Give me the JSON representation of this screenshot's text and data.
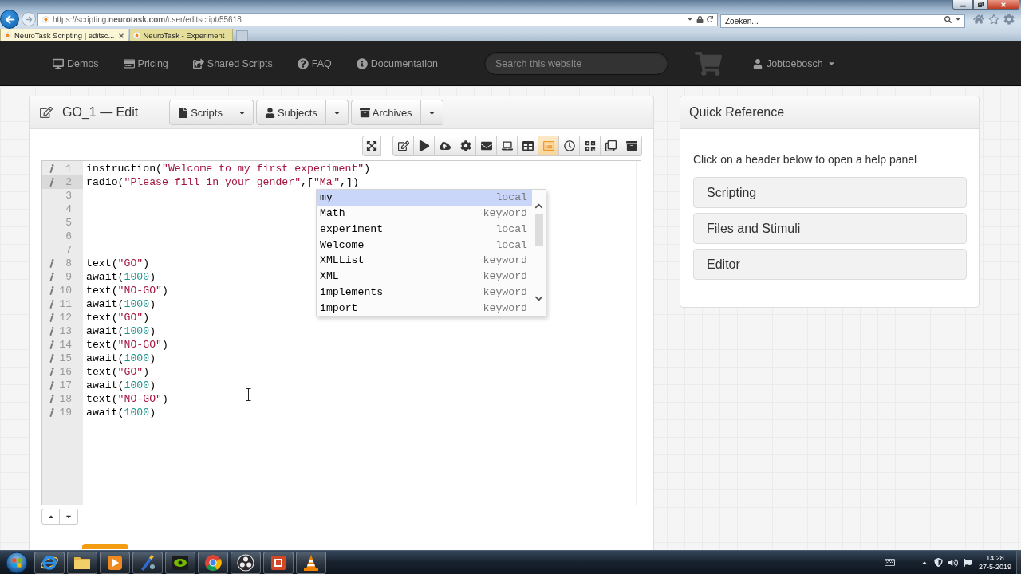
{
  "browser": {
    "address": "https://scripting.**neurotask.com**/user/editscript/55618",
    "search_placeholder": "Zoeken...",
    "tabs": [
      {
        "label": "NeuroTask Scripting | editsc...",
        "selected": true
      },
      {
        "label": "NeuroTask - Experiment",
        "selected": false
      }
    ]
  },
  "navbar": {
    "items": [
      "Demos",
      "Pricing",
      "Shared Scripts",
      "FAQ",
      "Documentation"
    ],
    "search_placeholder": "Search this website",
    "user": "Jobtoebosch"
  },
  "editor": {
    "title": "GO_1 — Edit",
    "menus": [
      "Scripts",
      "Subjects",
      "Archives"
    ],
    "tools": [
      {
        "selected": false
      },
      {
        "selected": false
      },
      {
        "selected": false
      },
      {
        "selected": false
      },
      {
        "selected": false
      },
      {
        "selected": false
      },
      {
        "selected": false
      },
      {
        "selected": true
      },
      {
        "selected": false
      },
      {
        "selected": false
      },
      {
        "selected": false
      },
      {
        "selected": false
      }
    ],
    "lines": [
      {
        "number": "1",
        "annotation": true,
        "active": false,
        "tokens": [
          {
            "kind": "plain",
            "text": "instruction("
          },
          {
            "kind": "string",
            "text": "\"Welcome to my first experiment\""
          },
          {
            "kind": "plain",
            "text": ")"
          }
        ]
      },
      {
        "number": "2",
        "annotation": true,
        "active": true,
        "tokens": [
          {
            "kind": "plain",
            "text": "radio("
          },
          {
            "kind": "string",
            "text": "\"Please fill in your gender\""
          },
          {
            "kind": "plain",
            "text": ",["
          },
          {
            "kind": "string",
            "text": "\"Ma"
          },
          {
            "kind": "caret"
          },
          {
            "kind": "string",
            "text": "\""
          },
          {
            "kind": "plain",
            "text": ",])"
          }
        ]
      },
      {
        "number": "3",
        "annotation": false,
        "active": false
      },
      {
        "number": "4",
        "annotation": false,
        "active": false
      },
      {
        "number": "5",
        "annotation": false,
        "active": false
      },
      {
        "number": "6",
        "annotation": false,
        "active": false
      },
      {
        "number": "7",
        "annotation": false,
        "active": false
      },
      {
        "number": "8",
        "annotation": true,
        "active": false,
        "tokens": [
          {
            "kind": "plain",
            "text": "text("
          },
          {
            "kind": "string",
            "text": "\"GO\""
          },
          {
            "kind": "plain",
            "text": ")"
          }
        ]
      },
      {
        "number": "9",
        "annotation": true,
        "active": false,
        "tokens": [
          {
            "kind": "plain",
            "text": "await("
          },
          {
            "kind": "number",
            "text": "1000"
          },
          {
            "kind": "plain",
            "text": ")"
          }
        ]
      },
      {
        "number": "10",
        "annotation": true,
        "active": false,
        "tokens": [
          {
            "kind": "plain",
            "text": "text("
          },
          {
            "kind": "string",
            "text": "\"NO-GO\""
          },
          {
            "kind": "plain",
            "text": ")"
          }
        ]
      },
      {
        "number": "11",
        "annotation": true,
        "active": false,
        "tokens": [
          {
            "kind": "plain",
            "text": "await("
          },
          {
            "kind": "number",
            "text": "1000"
          },
          {
            "kind": "plain",
            "text": ")"
          }
        ]
      },
      {
        "number": "12",
        "annotation": true,
        "active": false,
        "tokens": [
          {
            "kind": "plain",
            "text": "text("
          },
          {
            "kind": "string",
            "text": "\"GO\""
          },
          {
            "kind": "plain",
            "text": ")"
          }
        ]
      },
      {
        "number": "13",
        "annotation": true,
        "active": false,
        "tokens": [
          {
            "kind": "plain",
            "text": "await("
          },
          {
            "kind": "number",
            "text": "1000"
          },
          {
            "kind": "plain",
            "text": ")"
          }
        ]
      },
      {
        "number": "14",
        "annotation": true,
        "active": false,
        "tokens": [
          {
            "kind": "plain",
            "text": "text("
          },
          {
            "kind": "string",
            "text": "\"NO-GO\""
          },
          {
            "kind": "plain",
            "text": ")"
          }
        ]
      },
      {
        "number": "15",
        "annotation": true,
        "active": false,
        "tokens": [
          {
            "kind": "plain",
            "text": "await("
          },
          {
            "kind": "number",
            "text": "1000"
          },
          {
            "kind": "plain",
            "text": ")"
          }
        ]
      },
      {
        "number": "16",
        "annotation": true,
        "active": false,
        "tokens": [
          {
            "kind": "plain",
            "text": "text("
          },
          {
            "kind": "string",
            "text": "\"GO\""
          },
          {
            "kind": "plain",
            "text": ")"
          }
        ]
      },
      {
        "number": "17",
        "annotation": true,
        "active": false,
        "tokens": [
          {
            "kind": "plain",
            "text": "await("
          },
          {
            "kind": "number",
            "text": "1000"
          },
          {
            "kind": "plain",
            "text": ")"
          }
        ]
      },
      {
        "number": "18",
        "annotation": true,
        "active": false,
        "tokens": [
          {
            "kind": "plain",
            "text": "text("
          },
          {
            "kind": "string",
            "text": "\"NO-GO\""
          },
          {
            "kind": "plain",
            "text": ")"
          }
        ]
      },
      {
        "number": "19",
        "annotation": true,
        "active": false,
        "tokens": [
          {
            "kind": "plain",
            "text": "await("
          },
          {
            "kind": "number",
            "text": "1000"
          },
          {
            "kind": "plain",
            "text": ")"
          }
        ]
      }
    ],
    "autocomplete": [
      {
        "label": "my",
        "type": "local",
        "selected": true
      },
      {
        "label": "Math",
        "type": "keyword",
        "selected": false
      },
      {
        "label": "experiment",
        "type": "local",
        "selected": false
      },
      {
        "label": "Welcome",
        "type": "local",
        "selected": false
      },
      {
        "label": "XMLList",
        "type": "keyword",
        "selected": false
      },
      {
        "label": "XML",
        "type": "keyword",
        "selected": false
      },
      {
        "label": "implements",
        "type": "keyword",
        "selected": false
      },
      {
        "label": "import",
        "type": "keyword",
        "selected": false
      }
    ]
  },
  "quick_reference": {
    "title": "Quick Reference",
    "hint": "Click on a header below to open a help panel",
    "sections": [
      "Scripting",
      "Files and Stimuli",
      "Editor"
    ]
  },
  "taskbar": {
    "time": "14:28",
    "date": "27-5-2019"
  }
}
